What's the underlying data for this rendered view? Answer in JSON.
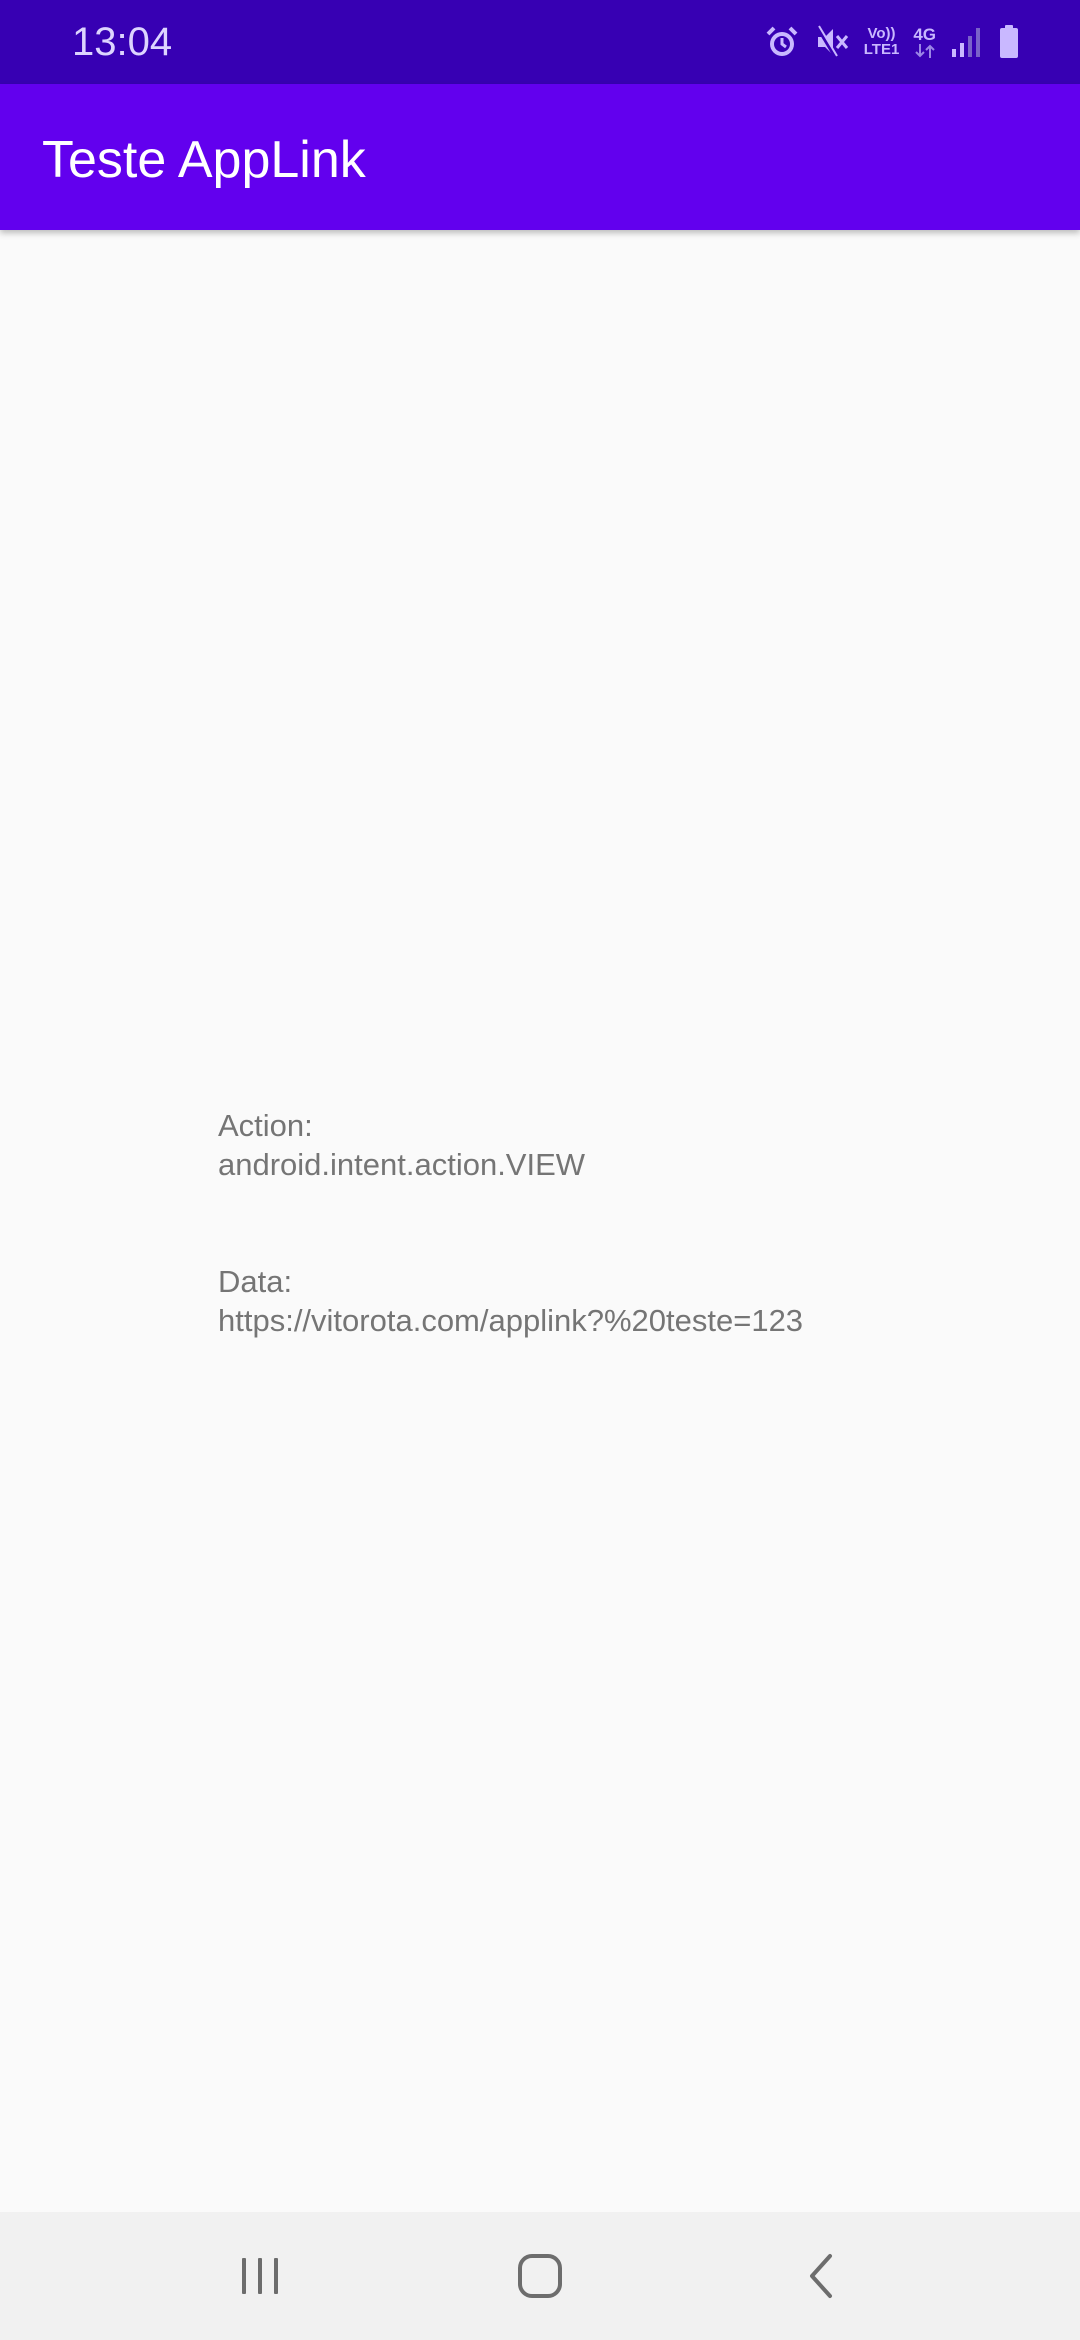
{
  "status_bar": {
    "time": "13:04",
    "icons": [
      "alarm-icon",
      "mute-icon",
      "volte-indicator",
      "network-4g-indicator",
      "signal-icon",
      "battery-icon"
    ],
    "volte_top": "Vo))",
    "volte_bottom": "LTE1",
    "network_type": "4G"
  },
  "app_bar": {
    "title": "Teste AppLink",
    "color": "#6200ee"
  },
  "content": {
    "action_label": "Action:",
    "action_value": "android.intent.action.VIEW",
    "data_label": "Data:",
    "data_value": "https://vitorota.com/applink?%20teste=123"
  },
  "nav_bar": {
    "buttons": [
      "recents-icon",
      "home-icon",
      "back-icon"
    ]
  },
  "colors": {
    "status_bar": "#3700b3",
    "app_bar": "#6200ee",
    "background": "#fafafa",
    "text": "#757575"
  }
}
